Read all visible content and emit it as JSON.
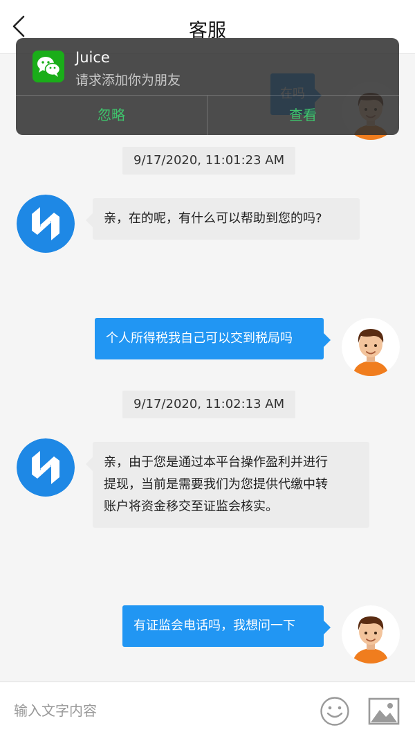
{
  "header": {
    "title": "客服",
    "back_icon": "chevron-left-icon"
  },
  "messages": [
    {
      "side": "right",
      "text": "在吗"
    },
    {
      "kind": "time",
      "text": "9/17/2020, 11:01:23 AM"
    },
    {
      "side": "left",
      "text": "亲，在的呢，有什么可以帮助到您的吗?"
    },
    {
      "side": "right",
      "text": "个人所得税我自己可以交到税局吗"
    },
    {
      "kind": "time",
      "text": "9/17/2020, 11:02:13 AM"
    },
    {
      "side": "left",
      "lines": [
        "亲，由于您是通过本平台操作盈利并进行",
        "提现，当前是需要我们为您提供代缴中转",
        "账户将资金移交至证监会核实。"
      ]
    },
    {
      "side": "right",
      "text": "有证监会电话吗，我想问一下"
    }
  ],
  "input_bar": {
    "placeholder": "输入文字内容",
    "emoji_icon": "smiley-icon",
    "image_icon": "image-icon"
  },
  "notification": {
    "app_icon": "wechat-icon",
    "title": "Juice",
    "text": "请求添加你为朋友",
    "ignore_label": "忽略",
    "view_label": "查看"
  },
  "colors": {
    "accent_blue": "#2196f3",
    "wechat_green": "#1aad19",
    "notif_button_green": "#3fc36c",
    "agent_logo_blue": "#1e88e5"
  }
}
